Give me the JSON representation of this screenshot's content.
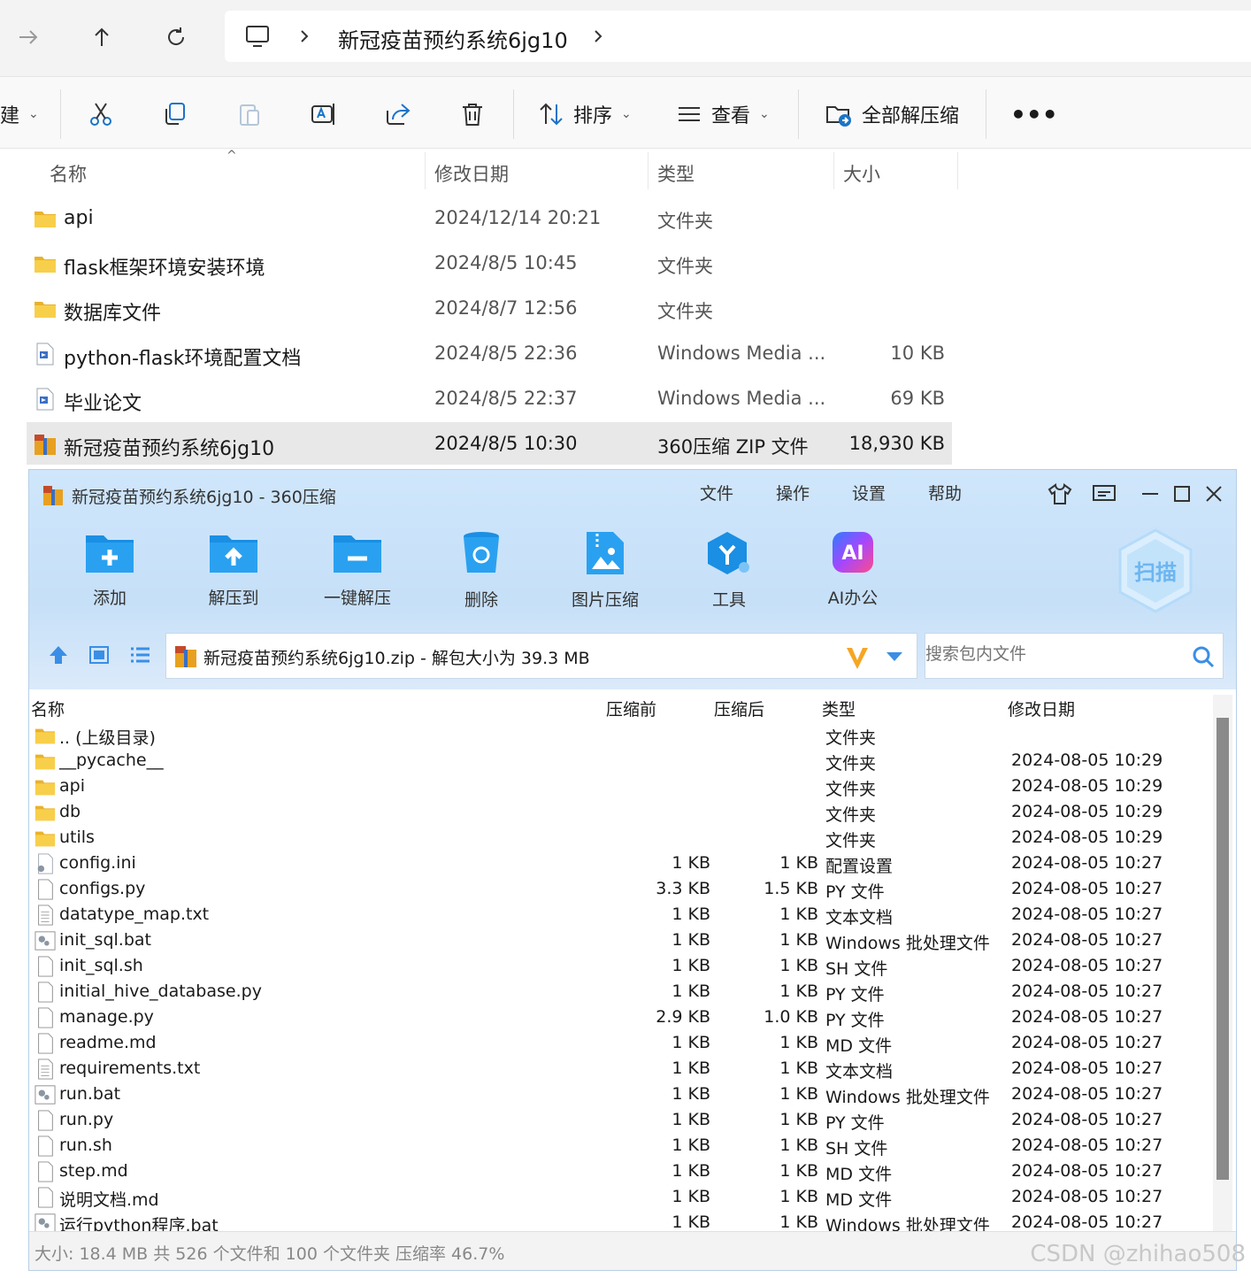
{
  "explorer": {
    "breadcrumb": {
      "current": "新冠疫苗预约系统6jg10"
    },
    "commandbar": {
      "new_label_fragment": "建",
      "sort_label": "排序",
      "view_label": "查看",
      "extract_all_label": "全部解压缩"
    },
    "columns": {
      "name": "名称",
      "date": "修改日期",
      "type": "类型",
      "size": "大小"
    },
    "rows": [
      {
        "icon": "folder-icon",
        "name": "api",
        "date": "2024/12/14 20:21",
        "type": "文件夹",
        "size": ""
      },
      {
        "icon": "folder-icon",
        "name": "flask框架环境安装环境",
        "date": "2024/8/5 10:45",
        "type": "文件夹",
        "size": ""
      },
      {
        "icon": "folder-icon",
        "name": "数据库文件",
        "date": "2024/8/7 12:56",
        "type": "文件夹",
        "size": ""
      },
      {
        "icon": "media-file-icon",
        "name": "python-flask环境配置文档",
        "date": "2024/8/5 22:36",
        "type": "Windows Media ...",
        "size": "10 KB"
      },
      {
        "icon": "media-file-icon",
        "name": "毕业论文",
        "date": "2024/8/5 22:37",
        "type": "Windows Media ...",
        "size": "69 KB"
      },
      {
        "icon": "zip-archive-icon",
        "name": "新冠疫苗预约系统6jg10",
        "date": "2024/8/5 10:30",
        "type": "360压缩 ZIP 文件",
        "size": "18,930 KB"
      }
    ]
  },
  "zip_window": {
    "title": "新冠疫苗预约系统6jg10 - 360压缩",
    "menu": [
      "文件",
      "操作",
      "设置",
      "帮助"
    ],
    "tools": [
      "添加",
      "解压到",
      "一键解压",
      "删除",
      "图片压缩",
      "工具",
      "AI办公"
    ],
    "scan_label": "扫描",
    "ai_badge": "AI",
    "path_text": "新冠疫苗预约系统6jg10.zip - 解包大小为 39.3 MB",
    "search_placeholder": "搜索包内文件",
    "columns": {
      "name": "名称",
      "before": "压缩前",
      "after": "压缩后",
      "type": "类型",
      "date": "修改日期"
    },
    "rows": [
      {
        "icon": "folder-icon",
        "name": ".. (上级目录)",
        "before": "",
        "after": "",
        "type": "文件夹",
        "date": ""
      },
      {
        "icon": "folder-icon",
        "name": "__pycache__",
        "before": "",
        "after": "",
        "type": "文件夹",
        "date": "2024-08-05 10:29"
      },
      {
        "icon": "folder-icon",
        "name": "api",
        "before": "",
        "after": "",
        "type": "文件夹",
        "date": "2024-08-05 10:29"
      },
      {
        "icon": "folder-icon",
        "name": "db",
        "before": "",
        "after": "",
        "type": "文件夹",
        "date": "2024-08-05 10:29"
      },
      {
        "icon": "folder-icon",
        "name": "utils",
        "before": "",
        "after": "",
        "type": "文件夹",
        "date": "2024-08-05 10:29"
      },
      {
        "icon": "settings-file-icon",
        "name": "config.ini",
        "before": "1 KB",
        "after": "1 KB",
        "type": "配置设置",
        "date": "2024-08-05 10:27"
      },
      {
        "icon": "blank-file-icon",
        "name": "configs.py",
        "before": "3.3 KB",
        "after": "1.5 KB",
        "type": "PY 文件",
        "date": "2024-08-05 10:27"
      },
      {
        "icon": "text-file-icon",
        "name": "datatype_map.txt",
        "before": "1 KB",
        "after": "1 KB",
        "type": "文本文档",
        "date": "2024-08-05 10:27"
      },
      {
        "icon": "batch-file-icon",
        "name": "init_sql.bat",
        "before": "1 KB",
        "after": "1 KB",
        "type": "Windows 批处理文件",
        "date": "2024-08-05 10:27"
      },
      {
        "icon": "blank-file-icon",
        "name": "init_sql.sh",
        "before": "1 KB",
        "after": "1 KB",
        "type": "SH 文件",
        "date": "2024-08-05 10:27"
      },
      {
        "icon": "blank-file-icon",
        "name": "initial_hive_database.py",
        "before": "1 KB",
        "after": "1 KB",
        "type": "PY 文件",
        "date": "2024-08-05 10:27"
      },
      {
        "icon": "blank-file-icon",
        "name": "manage.py",
        "before": "2.9 KB",
        "after": "1.0 KB",
        "type": "PY 文件",
        "date": "2024-08-05 10:27"
      },
      {
        "icon": "blank-file-icon",
        "name": "readme.md",
        "before": "1 KB",
        "after": "1 KB",
        "type": "MD 文件",
        "date": "2024-08-05 10:27"
      },
      {
        "icon": "text-file-icon",
        "name": "requirements.txt",
        "before": "1 KB",
        "after": "1 KB",
        "type": "文本文档",
        "date": "2024-08-05 10:27"
      },
      {
        "icon": "batch-file-icon",
        "name": "run.bat",
        "before": "1 KB",
        "after": "1 KB",
        "type": "Windows 批处理文件",
        "date": "2024-08-05 10:27"
      },
      {
        "icon": "blank-file-icon",
        "name": "run.py",
        "before": "1 KB",
        "after": "1 KB",
        "type": "PY 文件",
        "date": "2024-08-05 10:27"
      },
      {
        "icon": "blank-file-icon",
        "name": "run.sh",
        "before": "1 KB",
        "after": "1 KB",
        "type": "SH 文件",
        "date": "2024-08-05 10:27"
      },
      {
        "icon": "blank-file-icon",
        "name": "step.md",
        "before": "1 KB",
        "after": "1 KB",
        "type": "MD 文件",
        "date": "2024-08-05 10:27"
      },
      {
        "icon": "blank-file-icon",
        "name": "说明文档.md",
        "before": "1 KB",
        "after": "1 KB",
        "type": "MD 文件",
        "date": "2024-08-05 10:27"
      },
      {
        "icon": "batch-file-icon",
        "name": "运行python程序.bat",
        "before": "1 KB",
        "after": "1 KB",
        "type": "Windows 批处理文件",
        "date": "2024-08-05 10:27"
      }
    ],
    "status": "大小: 18.4 MB 共 526 个文件和 100 个文件夹 压缩率 46.7%"
  },
  "watermark": "CSDN @zhihao508",
  "colors": {
    "folder": "#f4c542",
    "accent_blue": "#1a8fe3",
    "zip_header_bg": "#cfe6fb",
    "selection": "#e8e8e8"
  }
}
